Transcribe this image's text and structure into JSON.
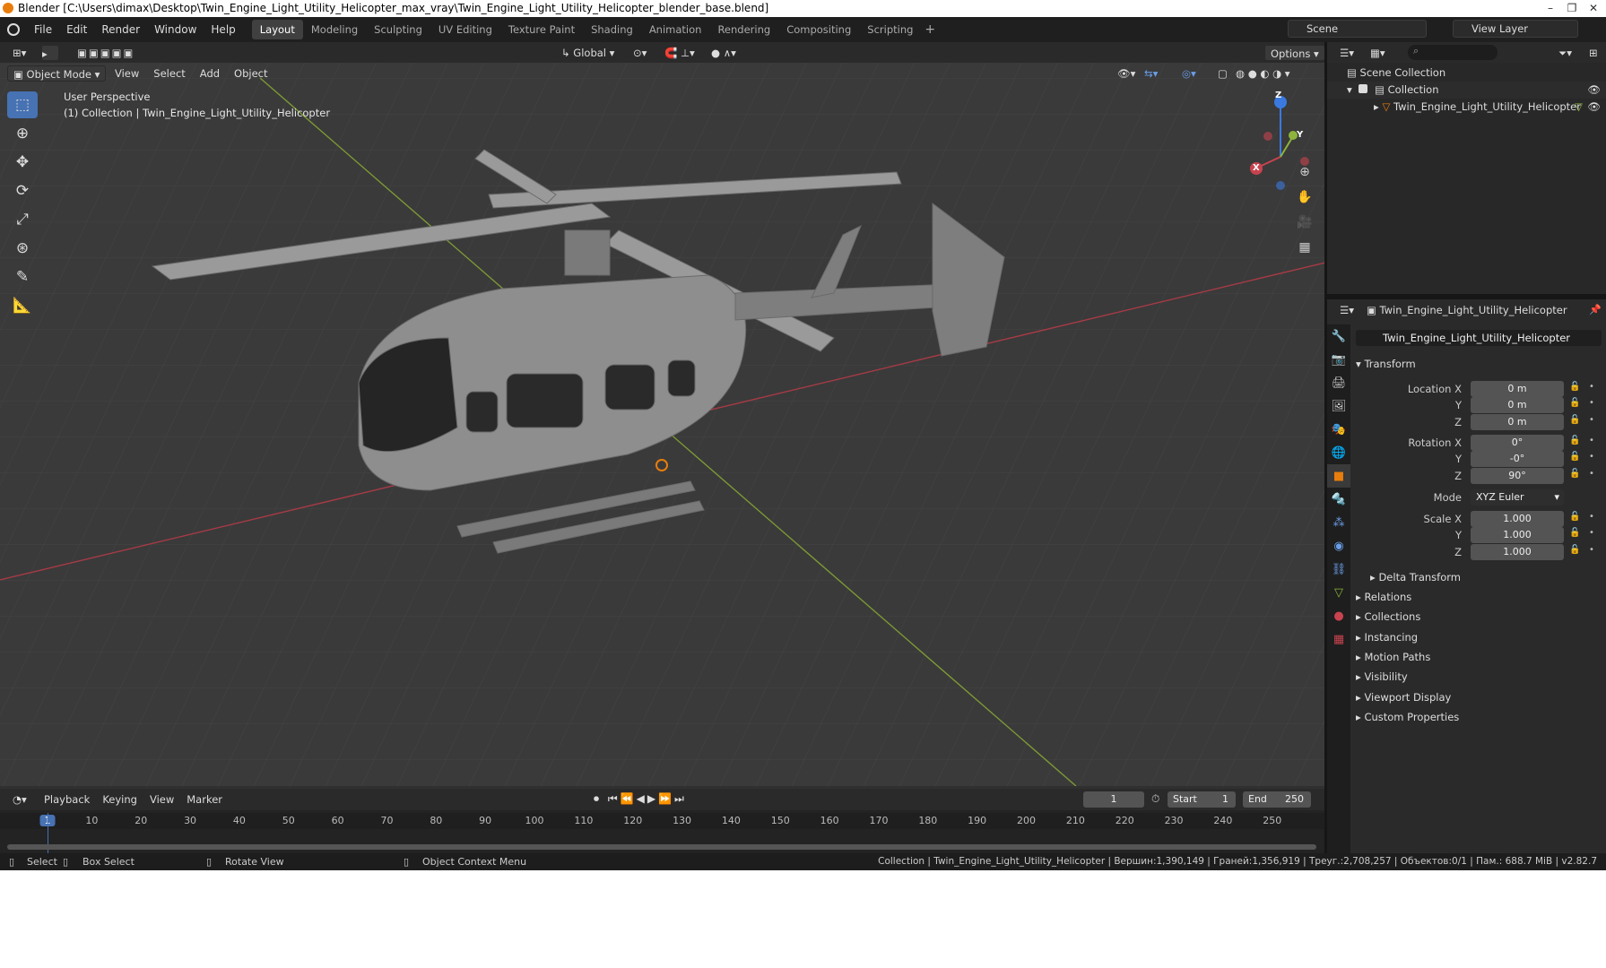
{
  "window": {
    "title": "Blender [C:\\Users\\dimax\\Desktop\\Twin_Engine_Light_Utility_Helicopter_max_vray\\Twin_Engine_Light_Utility_Helicopter_blender_base.blend]"
  },
  "menubar": {
    "items": [
      "File",
      "Edit",
      "Render",
      "Window",
      "Help"
    ]
  },
  "workspaces": [
    "Layout",
    "Modeling",
    "Sculpting",
    "UV Editing",
    "Texture Paint",
    "Shading",
    "Animation",
    "Rendering",
    "Compositing",
    "Scripting"
  ],
  "workspace_add": "+",
  "scene": {
    "name": "Scene"
  },
  "view_layer": {
    "name": "View Layer"
  },
  "viewport_header": {
    "mode": "Object Mode",
    "menus": [
      "View",
      "Select",
      "Add",
      "Object"
    ],
    "orientation": "Global",
    "options": "Options"
  },
  "viewport": {
    "perspective": "User Perspective",
    "collection_info": "(1) Collection | Twin_Engine_Light_Utility_Helicopter",
    "gizmo": {
      "x": "X",
      "y": "Y",
      "z": "Z"
    }
  },
  "outliner": {
    "scene_collection": "Scene Collection",
    "collection": "Collection",
    "object": "Twin_Engine_Light_Utility_Helicopter"
  },
  "properties": {
    "header_object": "Twin_Engine_Light_Utility_Helicopter",
    "object_name": "Twin_Engine_Light_Utility_Helicopter",
    "transform_label": "Transform",
    "location": {
      "label_x": "Location X",
      "label_y": "Y",
      "label_z": "Z",
      "x": "0 m",
      "y": "0 m",
      "z": "0 m"
    },
    "rotation": {
      "label_x": "Rotation X",
      "label_y": "Y",
      "label_z": "Z",
      "x": "0°",
      "y": "-0°",
      "z": "90°"
    },
    "mode": {
      "label": "Mode",
      "value": "XYZ Euler"
    },
    "scale": {
      "label_x": "Scale X",
      "label_y": "Y",
      "label_z": "Z",
      "x": "1.000",
      "y": "1.000",
      "z": "1.000"
    },
    "delta_transform": "Delta Transform",
    "panels": [
      "Relations",
      "Collections",
      "Instancing",
      "Motion Paths",
      "Visibility",
      "Viewport Display",
      "Custom Properties"
    ]
  },
  "timeline": {
    "menus": [
      "Playback",
      "Keying",
      "View",
      "Marker"
    ],
    "current_frame": "1",
    "start_label": "Start",
    "start": "1",
    "end_label": "End",
    "end": "250",
    "ticks": [
      "1",
      "10",
      "20",
      "30",
      "40",
      "50",
      "60",
      "70",
      "80",
      "90",
      "100",
      "110",
      "120",
      "130",
      "140",
      "150",
      "160",
      "170",
      "180",
      "190",
      "200",
      "210",
      "220",
      "230",
      "240",
      "250"
    ]
  },
  "statusbar": {
    "select": "Select",
    "box_select": "Box Select",
    "rotate_view": "Rotate View",
    "context_menu": "Object Context Menu",
    "stats": "Collection | Twin_Engine_Light_Utility_Helicopter | Вершин:1,390,149 | Граней:1,356,919 | Треуг.:2,708,257 | Объектов:0/1 | Пам.: 688.7 MiB | v2.82.7"
  },
  "colors": {
    "accent": "#4772b3",
    "x_axis": "#c8434f",
    "y_axis": "#8cb43c",
    "z_axis": "#3a7ae0",
    "object_orange": "#e87d0d"
  }
}
